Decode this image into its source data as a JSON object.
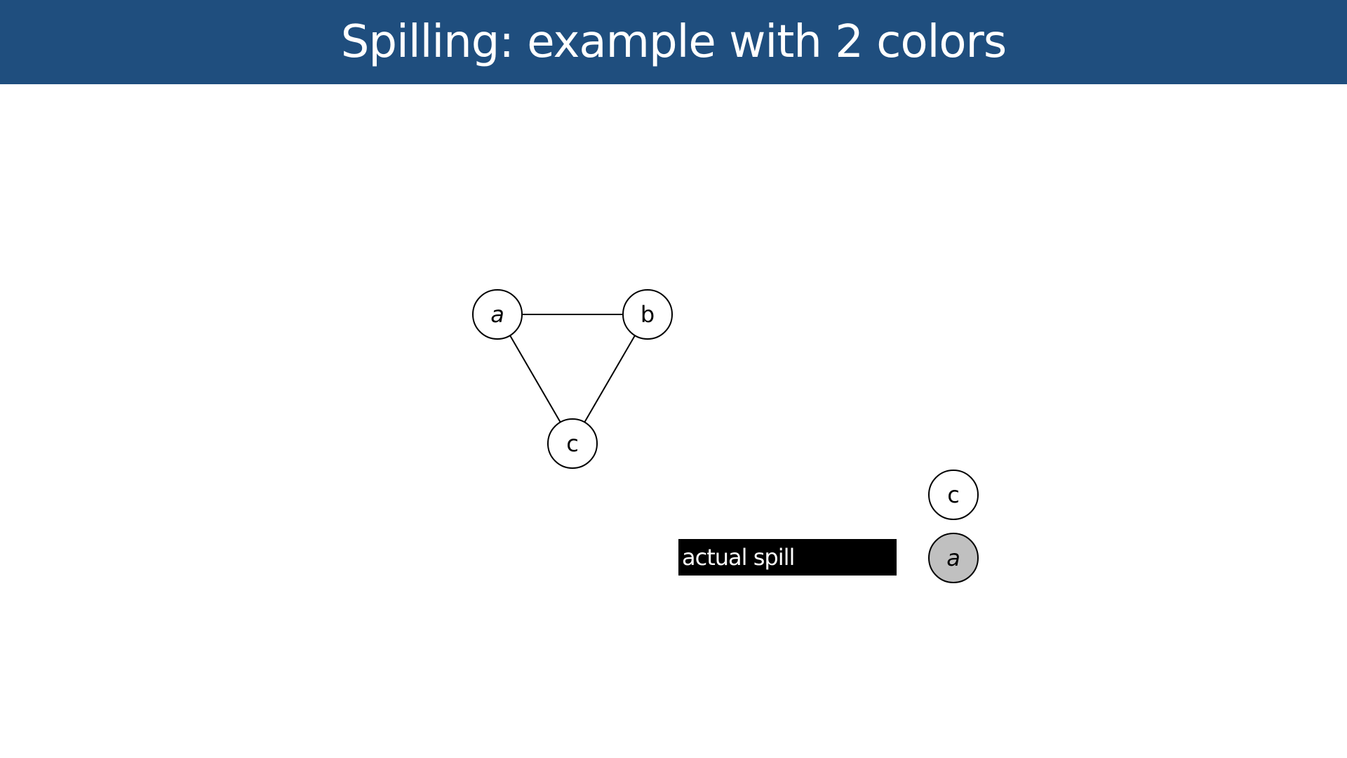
{
  "slide": {
    "title": "Spilling: example with 2 colors"
  },
  "colors": {
    "header": "#1f4e7e",
    "spilled_node": "#c0c0c0",
    "node": "#ffffff",
    "spill_box": "#000000"
  },
  "graph": {
    "nodes": [
      {
        "id": "a",
        "label": "a"
      },
      {
        "id": "b",
        "label": "b"
      },
      {
        "id": "c",
        "label": "c"
      }
    ],
    "edges": [
      [
        "a",
        "b"
      ],
      [
        "a",
        "c"
      ],
      [
        "b",
        "c"
      ]
    ]
  },
  "stack": {
    "top": {
      "label": "c",
      "spilled": false
    },
    "bottom": {
      "label": "a",
      "spilled": true
    }
  },
  "spill_note": "actual spill"
}
